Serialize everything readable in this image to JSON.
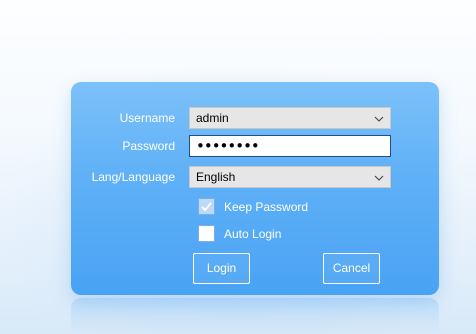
{
  "login_form": {
    "username": {
      "label": "Username",
      "value": "admin",
      "icon": "chevron-down-icon"
    },
    "password": {
      "label": "Password",
      "masked_value": "••••••••"
    },
    "language": {
      "label": "Lang/Language",
      "value": "English",
      "icon": "chevron-down-icon"
    },
    "keep_password": {
      "label": "Keep Password",
      "checked": true
    },
    "auto_login": {
      "label": "Auto Login",
      "checked": false
    },
    "buttons": {
      "login": "Login",
      "cancel": "Cancel"
    }
  },
  "colors": {
    "panel_top": "#7cc1f9",
    "panel_bottom": "#49a3f4",
    "label_text": "#ffffff"
  }
}
